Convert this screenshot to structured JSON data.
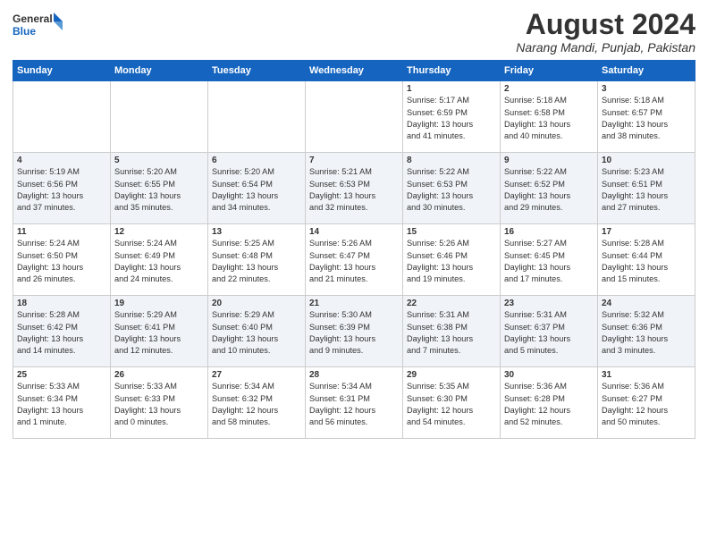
{
  "header": {
    "logo_line1": "General",
    "logo_line2": "Blue",
    "title": "August 2024",
    "subtitle": "Narang Mandi, Punjab, Pakistan"
  },
  "columns": [
    "Sunday",
    "Monday",
    "Tuesday",
    "Wednesday",
    "Thursday",
    "Friday",
    "Saturday"
  ],
  "weeks": [
    [
      {
        "day": "",
        "info": ""
      },
      {
        "day": "",
        "info": ""
      },
      {
        "day": "",
        "info": ""
      },
      {
        "day": "",
        "info": ""
      },
      {
        "day": "1",
        "info": "Sunrise: 5:17 AM\nSunset: 6:59 PM\nDaylight: 13 hours\nand 41 minutes."
      },
      {
        "day": "2",
        "info": "Sunrise: 5:18 AM\nSunset: 6:58 PM\nDaylight: 13 hours\nand 40 minutes."
      },
      {
        "day": "3",
        "info": "Sunrise: 5:18 AM\nSunset: 6:57 PM\nDaylight: 13 hours\nand 38 minutes."
      }
    ],
    [
      {
        "day": "4",
        "info": "Sunrise: 5:19 AM\nSunset: 6:56 PM\nDaylight: 13 hours\nand 37 minutes."
      },
      {
        "day": "5",
        "info": "Sunrise: 5:20 AM\nSunset: 6:55 PM\nDaylight: 13 hours\nand 35 minutes."
      },
      {
        "day": "6",
        "info": "Sunrise: 5:20 AM\nSunset: 6:54 PM\nDaylight: 13 hours\nand 34 minutes."
      },
      {
        "day": "7",
        "info": "Sunrise: 5:21 AM\nSunset: 6:53 PM\nDaylight: 13 hours\nand 32 minutes."
      },
      {
        "day": "8",
        "info": "Sunrise: 5:22 AM\nSunset: 6:53 PM\nDaylight: 13 hours\nand 30 minutes."
      },
      {
        "day": "9",
        "info": "Sunrise: 5:22 AM\nSunset: 6:52 PM\nDaylight: 13 hours\nand 29 minutes."
      },
      {
        "day": "10",
        "info": "Sunrise: 5:23 AM\nSunset: 6:51 PM\nDaylight: 13 hours\nand 27 minutes."
      }
    ],
    [
      {
        "day": "11",
        "info": "Sunrise: 5:24 AM\nSunset: 6:50 PM\nDaylight: 13 hours\nand 26 minutes."
      },
      {
        "day": "12",
        "info": "Sunrise: 5:24 AM\nSunset: 6:49 PM\nDaylight: 13 hours\nand 24 minutes."
      },
      {
        "day": "13",
        "info": "Sunrise: 5:25 AM\nSunset: 6:48 PM\nDaylight: 13 hours\nand 22 minutes."
      },
      {
        "day": "14",
        "info": "Sunrise: 5:26 AM\nSunset: 6:47 PM\nDaylight: 13 hours\nand 21 minutes."
      },
      {
        "day": "15",
        "info": "Sunrise: 5:26 AM\nSunset: 6:46 PM\nDaylight: 13 hours\nand 19 minutes."
      },
      {
        "day": "16",
        "info": "Sunrise: 5:27 AM\nSunset: 6:45 PM\nDaylight: 13 hours\nand 17 minutes."
      },
      {
        "day": "17",
        "info": "Sunrise: 5:28 AM\nSunset: 6:44 PM\nDaylight: 13 hours\nand 15 minutes."
      }
    ],
    [
      {
        "day": "18",
        "info": "Sunrise: 5:28 AM\nSunset: 6:42 PM\nDaylight: 13 hours\nand 14 minutes."
      },
      {
        "day": "19",
        "info": "Sunrise: 5:29 AM\nSunset: 6:41 PM\nDaylight: 13 hours\nand 12 minutes."
      },
      {
        "day": "20",
        "info": "Sunrise: 5:29 AM\nSunset: 6:40 PM\nDaylight: 13 hours\nand 10 minutes."
      },
      {
        "day": "21",
        "info": "Sunrise: 5:30 AM\nSunset: 6:39 PM\nDaylight: 13 hours\nand 9 minutes."
      },
      {
        "day": "22",
        "info": "Sunrise: 5:31 AM\nSunset: 6:38 PM\nDaylight: 13 hours\nand 7 minutes."
      },
      {
        "day": "23",
        "info": "Sunrise: 5:31 AM\nSunset: 6:37 PM\nDaylight: 13 hours\nand 5 minutes."
      },
      {
        "day": "24",
        "info": "Sunrise: 5:32 AM\nSunset: 6:36 PM\nDaylight: 13 hours\nand 3 minutes."
      }
    ],
    [
      {
        "day": "25",
        "info": "Sunrise: 5:33 AM\nSunset: 6:34 PM\nDaylight: 13 hours\nand 1 minute."
      },
      {
        "day": "26",
        "info": "Sunrise: 5:33 AM\nSunset: 6:33 PM\nDaylight: 13 hours\nand 0 minutes."
      },
      {
        "day": "27",
        "info": "Sunrise: 5:34 AM\nSunset: 6:32 PM\nDaylight: 12 hours\nand 58 minutes."
      },
      {
        "day": "28",
        "info": "Sunrise: 5:34 AM\nSunset: 6:31 PM\nDaylight: 12 hours\nand 56 minutes."
      },
      {
        "day": "29",
        "info": "Sunrise: 5:35 AM\nSunset: 6:30 PM\nDaylight: 12 hours\nand 54 minutes."
      },
      {
        "day": "30",
        "info": "Sunrise: 5:36 AM\nSunset: 6:28 PM\nDaylight: 12 hours\nand 52 minutes."
      },
      {
        "day": "31",
        "info": "Sunrise: 5:36 AM\nSunset: 6:27 PM\nDaylight: 12 hours\nand 50 minutes."
      }
    ]
  ]
}
